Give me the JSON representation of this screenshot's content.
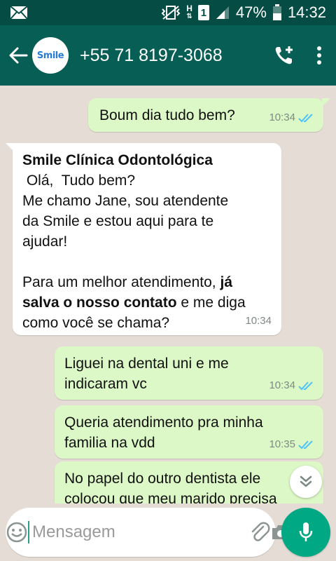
{
  "status_bar": {
    "battery": "47%",
    "time": "14:32",
    "network": "H",
    "sim_slot": "1"
  },
  "header": {
    "avatar_text": "Smile",
    "contact": "+55 71 8197-3068"
  },
  "messages": [
    {
      "dir": "out",
      "text": "Boum dia tudo bem?",
      "time": "10:34"
    },
    {
      "dir": "in",
      "sender": "Smile Clínica Odontológica",
      "lines": [
        " Olá,  Tudo bem?",
        "Me chamo Jane, sou atendente",
        "da Smile e estou aqui para te",
        "ajudar!",
        "",
        "Para um melhor atendimento, "
      ],
      "bold": "já salva o nosso contato",
      "after_bold": " e me diga como você se chama?",
      "time": "10:34"
    },
    {
      "dir": "out",
      "text": "Liguei na dental uni e me indicaram vc",
      "time": "10:34"
    },
    {
      "dir": "out",
      "text": "Queria atendimento pra minha familia na vdd",
      "time": "10:35"
    },
    {
      "dir": "out",
      "text": "No papel do outro dentista ele colocou que meu marido precisa",
      "time": ""
    }
  ],
  "input": {
    "placeholder": "Mensagem"
  },
  "colors": {
    "header": "#075e54",
    "statusbar": "#054d44",
    "out_bubble": "#dcf8c6",
    "in_bubble": "#ffffff",
    "accent": "#00a884",
    "ticks": "#4fc3f7"
  }
}
